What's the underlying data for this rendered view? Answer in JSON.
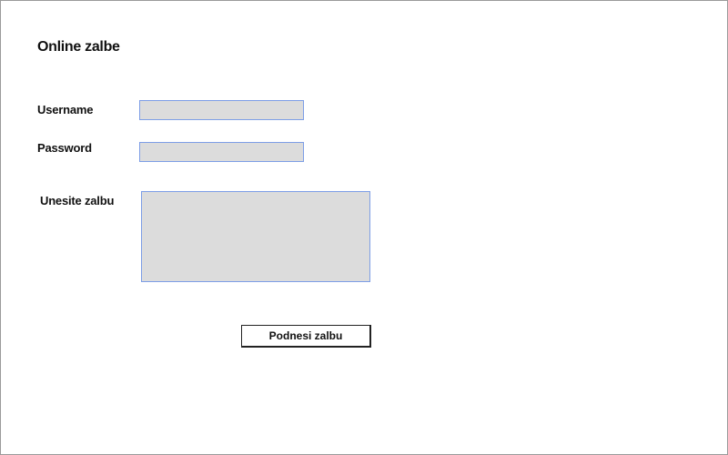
{
  "page": {
    "title": "Online zalbe"
  },
  "form": {
    "username_label": "Username",
    "username_value": "",
    "password_label": "Password",
    "password_value": "",
    "complaint_label": "Unesite zalbu",
    "complaint_value": "",
    "submit_label": "Podnesi zalbu"
  },
  "colors": {
    "field_background": "#dcdcdc",
    "field_border": "#7d9ee6"
  }
}
